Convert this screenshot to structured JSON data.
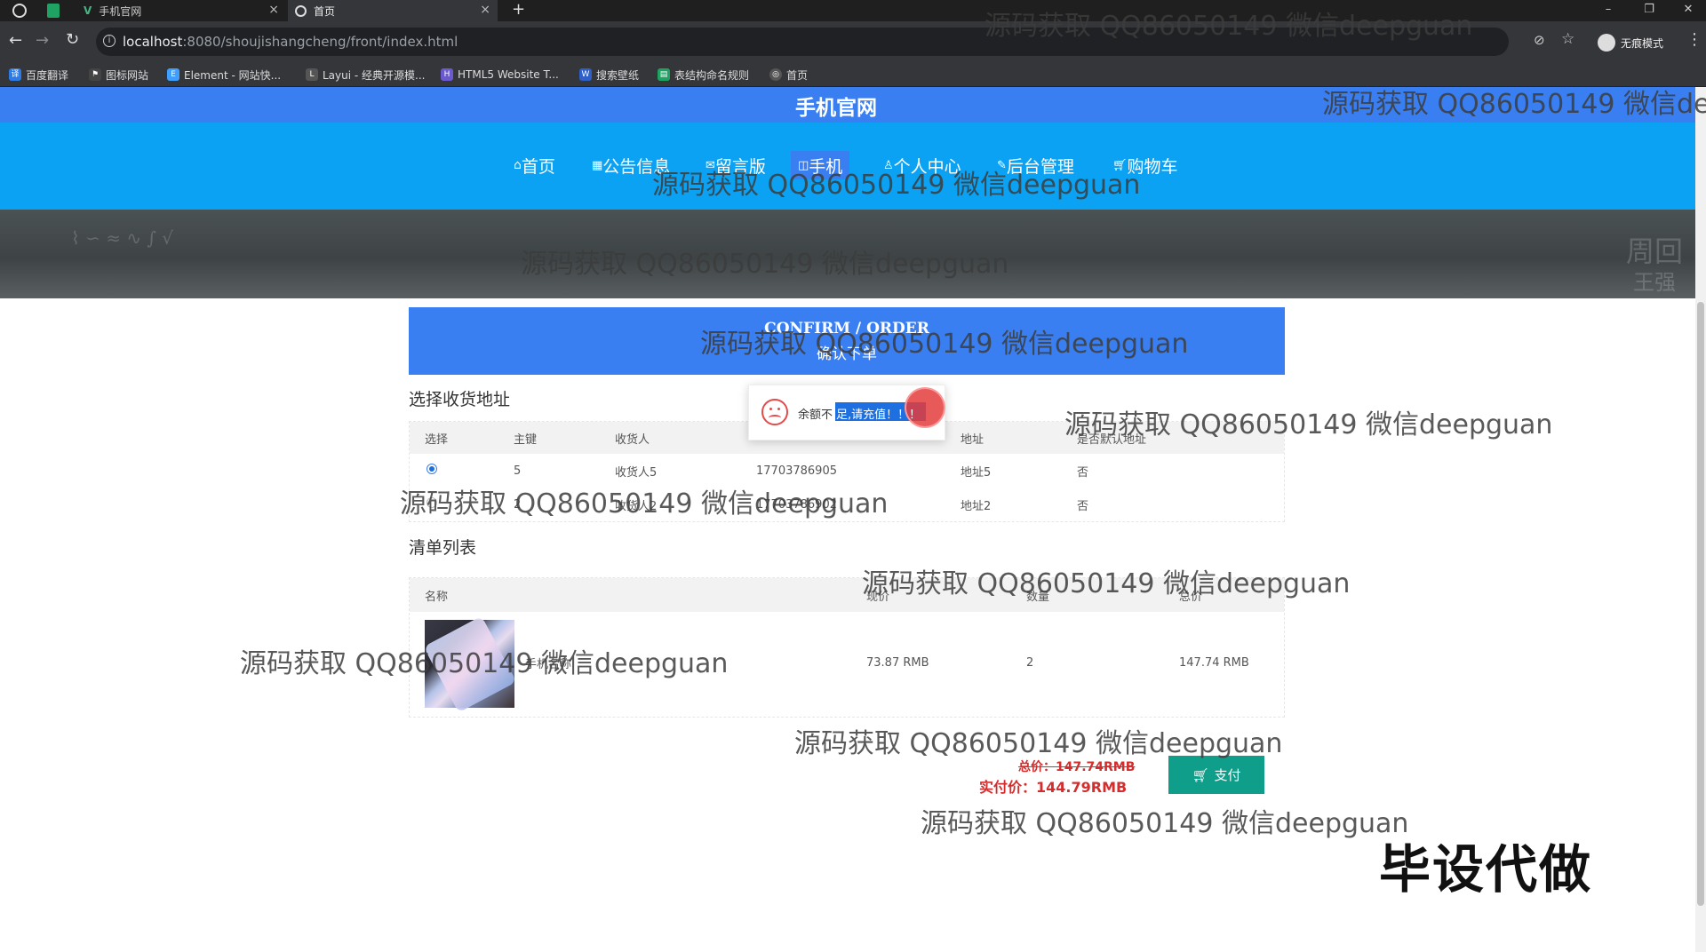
{
  "browser": {
    "tabs": [
      {
        "label": "手机官网",
        "active": false
      },
      {
        "label": "首页",
        "active": true
      }
    ],
    "new_tab": "+",
    "url_host": "localhost",
    "url_path": ":8080/shoujishangcheng/front/index.html",
    "incognito_label": "无痕模式",
    "bookmarks": [
      "百度翻译",
      "图标网站",
      "Element - 网站快...",
      "Layui - 经典开源模...",
      "HTML5 Website T...",
      "搜索壁纸",
      "表结构命名规则",
      "首页"
    ]
  },
  "site": {
    "title": "手机官网",
    "nav": [
      {
        "label": "首页",
        "icon": "home-icon",
        "active": false
      },
      {
        "label": "公告信息",
        "icon": "news-icon",
        "active": false
      },
      {
        "label": "留言版",
        "icon": "message-icon",
        "active": false
      },
      {
        "label": "手机",
        "icon": "phone-icon",
        "active": true
      },
      {
        "label": "个人中心",
        "icon": "user-icon",
        "active": false
      },
      {
        "label": "后台管理",
        "icon": "admin-icon",
        "active": false
      },
      {
        "label": "购物车",
        "icon": "cart-icon",
        "active": false
      }
    ],
    "banner_scribbles": [
      "周回",
      "王强"
    ]
  },
  "confirm": {
    "title_en": "CONFIRM / ORDER",
    "title_zh": "确认下单"
  },
  "address": {
    "heading": "选择收货地址",
    "columns": [
      "选择",
      "主键",
      "收货人",
      "",
      "地址",
      "是否默认地址"
    ],
    "rows": [
      {
        "selected": true,
        "id": "5",
        "name": "收货人5",
        "phone": "17703786905",
        "address": "地址5",
        "default": "否"
      },
      {
        "selected": false,
        "id": "2",
        "name": "收货人2",
        "phone": "17703786902",
        "address": "地址2",
        "default": "否"
      }
    ]
  },
  "cart": {
    "heading": "清单列表",
    "columns": [
      "名称",
      "现价",
      "数量",
      "总价"
    ],
    "rows": [
      {
        "name": "手机名称",
        "price": "73.87 RMB",
        "qty": "2",
        "total": "147.74 RMB"
      }
    ]
  },
  "totals": {
    "original": "总价：147.74RMB",
    "actual": "实付价：144.79RMB",
    "pay_label": "支付"
  },
  "popup": {
    "message_prefix": "余额不",
    "message_selected": "足,请充值！！！"
  },
  "watermark": "源码获取 QQ86050149 微信deepguan",
  "watermark_cut": "源码获取 QQ86050149 微信de",
  "corner_mark": "毕设代做"
}
